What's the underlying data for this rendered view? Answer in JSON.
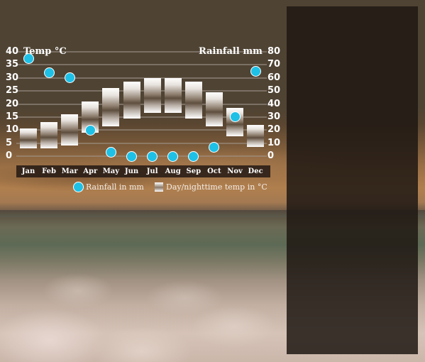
{
  "colors": {
    "background_brown": "#4f4333",
    "panel_dark": "#231b16",
    "rain_dot": "#1ec0e6",
    "text": "#ffffff"
  },
  "chart_data": {
    "type": "bar",
    "title": "",
    "categories": [
      "Jan",
      "Feb",
      "Mar",
      "Apr",
      "May",
      "Jun",
      "Jul",
      "Aug",
      "Sep",
      "Oct",
      "Nov",
      "Dec"
    ],
    "series": [
      {
        "name": "Day/nighttime temp in °C",
        "kind": "floating-bar",
        "axis": "left",
        "low": [
          3,
          3,
          4,
          9,
          11.5,
          14.5,
          16.5,
          16.5,
          14.5,
          11.5,
          7.5,
          3.5
        ],
        "high": [
          10.5,
          13,
          16,
          21,
          26,
          28.5,
          30,
          30,
          28.5,
          24.5,
          18.5,
          12
        ]
      },
      {
        "name": "Rainfall in mm",
        "kind": "scatter",
        "axis": "right",
        "values": [
          75,
          64,
          60,
          20,
          3,
          0,
          0,
          0,
          0,
          7,
          30,
          65
        ]
      }
    ],
    "left_axis": {
      "label": "Temp °C",
      "ylim": [
        0,
        40
      ],
      "ticks": [
        "0",
        "5",
        "10",
        "15",
        "20",
        "25",
        "30",
        "35",
        "40"
      ]
    },
    "right_axis": {
      "label": "Rainfall mm",
      "ylim": [
        0,
        80
      ],
      "ticks": [
        "0",
        "10",
        "20",
        "30",
        "40",
        "50",
        "60",
        "70",
        "80"
      ]
    },
    "grid": true,
    "legend": {
      "placement": "bottom",
      "items": [
        {
          "label": "Rainfall in mm",
          "symbol": "dot"
        },
        {
          "label": "Day/nighttime temp in °C",
          "symbol": "gradient-swatch"
        }
      ]
    }
  }
}
